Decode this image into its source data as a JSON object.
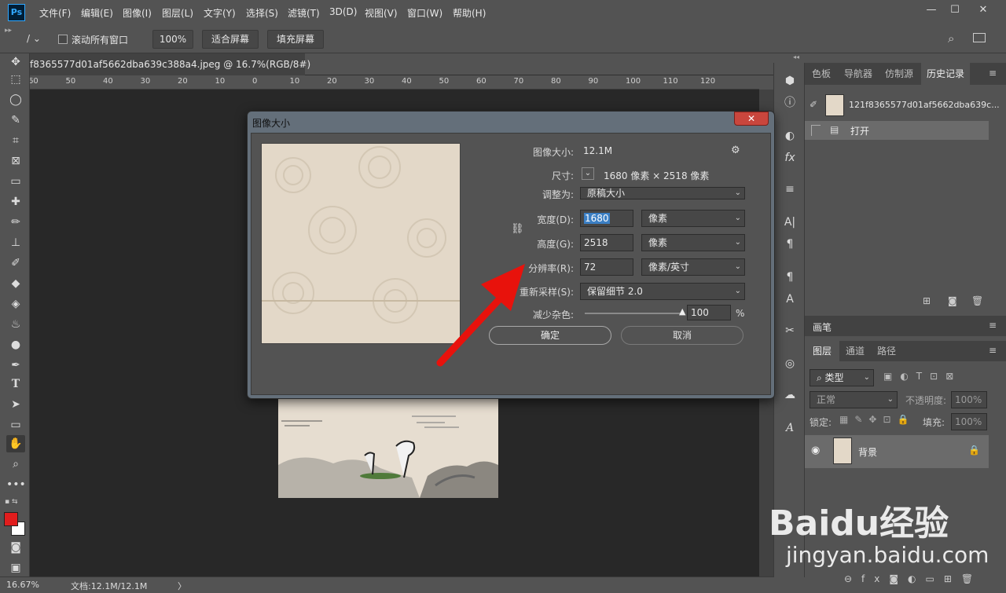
{
  "menubar": {
    "logo": "Ps",
    "items": [
      "文件(F)",
      "编辑(E)",
      "图像(I)",
      "图层(L)",
      "文字(Y)",
      "选择(S)",
      "滤镜(T)",
      "3D(D)",
      "视图(V)",
      "窗口(W)",
      "帮助(H)"
    ]
  },
  "window_controls": {
    "minimize": "—",
    "restore": "☐",
    "close": "✕"
  },
  "options_bar": {
    "scroll_all_label": "滚动所有窗口",
    "zoom_value": "100%",
    "fit_screen": "适合屏幕",
    "fill_screen": "填充屏幕"
  },
  "document": {
    "tab_title": "f8365577d01af5662dba639c388a4.jpeg @ 16.7%(RGB/8#)",
    "tab_close": "✕",
    "ruler_ticks": [
      "60",
      "50",
      "40",
      "30",
      "20",
      "10",
      "0",
      "10",
      "20",
      "30",
      "40",
      "50",
      "60",
      "70",
      "80",
      "90",
      "100",
      "110",
      "120"
    ]
  },
  "status_bar": {
    "zoom": "16.67%",
    "doc_info": "文档:12.1M/12.1M",
    "arrow": "〉"
  },
  "dialog": {
    "title": "图像大小",
    "close": "✕",
    "image_size_label": "图像大小:",
    "image_size_value": "12.1M",
    "dimensions_label": "尺寸:",
    "dimensions_value": "1680 像素 × 2518 像素",
    "fit_to_label": "调整为:",
    "fit_to_value": "原稿大小",
    "width_label": "宽度(D):",
    "width_value": "1680",
    "width_unit": "像素",
    "height_label": "高度(G):",
    "height_value": "2518",
    "height_unit": "像素",
    "resolution_label": "分辨率(R):",
    "resolution_value": "72",
    "resolution_unit": "像素/英寸",
    "resample_label": "重新采样(S):",
    "resample_value": "保留细节 2.0",
    "reduce_noise_label": "减少杂色:",
    "reduce_noise_value": "100",
    "reduce_noise_unit": "%",
    "reduce_noise_level": 1.0,
    "ok_label": "确定",
    "cancel_label": "取消"
  },
  "right_panel": {
    "top_tabs": [
      "色板",
      "导航器",
      "仿制源",
      "历史记录"
    ],
    "active_top_tab": "历史记录",
    "history_snapshot": "121f8365577d01af5662dba639c...",
    "history_items": [
      "打开"
    ],
    "brush_header": "画笔",
    "layer_tabs": [
      "图层",
      "通道",
      "路径"
    ],
    "active_layer_tab": "图层",
    "filter_kind": "类型",
    "blend_mode": "正常",
    "opacity_label": "不透明度:",
    "opacity_value": "100%",
    "lock_label": "锁定:",
    "fill_label": "填充:",
    "fill_value": "100%",
    "layers": [
      {
        "name": "背景",
        "locked": true
      }
    ]
  },
  "watermark": {
    "brand": "Baidu经验",
    "url": "jingyan.baidu.com"
  },
  "colors": {
    "foreground": "#e11d1d",
    "background": "#ffffff",
    "arrow": "#e8120c",
    "ui_bg": "#535353"
  }
}
